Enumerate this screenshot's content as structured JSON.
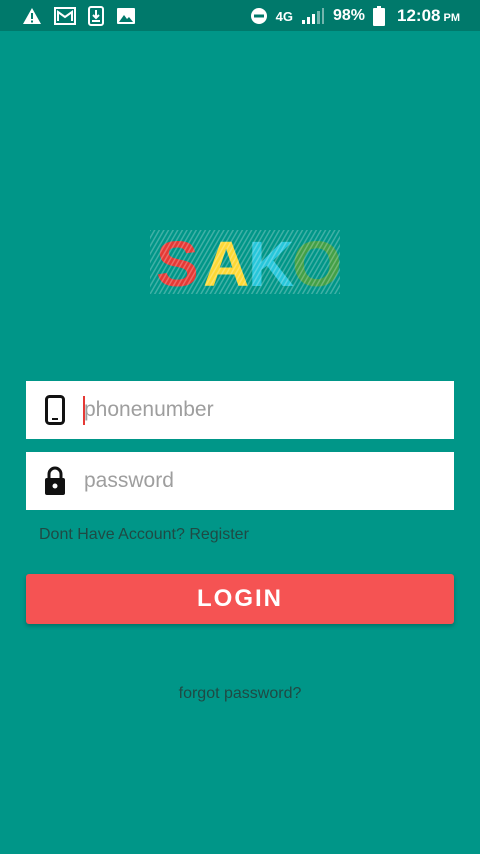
{
  "status_bar": {
    "network": "4G",
    "battery": "98%",
    "time": "12:08",
    "ampm": "PM",
    "icons": [
      "warning-icon",
      "gmail-icon",
      "download-icon",
      "image-icon",
      "do-not-disturb-icon",
      "signal-icon",
      "battery-icon"
    ]
  },
  "logo": {
    "letters": [
      "S",
      "A",
      "K",
      "O"
    ],
    "colors": [
      "#e53935",
      "#fdd835",
      "#26c6da",
      "#43a047"
    ]
  },
  "login_form": {
    "phone_placeholder": "phonenumber",
    "password_placeholder": "password",
    "register_text": "Dont Have Account? Register",
    "login_label": "LOGIN",
    "forgot_text": "forgot password?"
  },
  "colors": {
    "background": "#009688",
    "status_bar": "#00796b",
    "login_button": "#f55353"
  }
}
